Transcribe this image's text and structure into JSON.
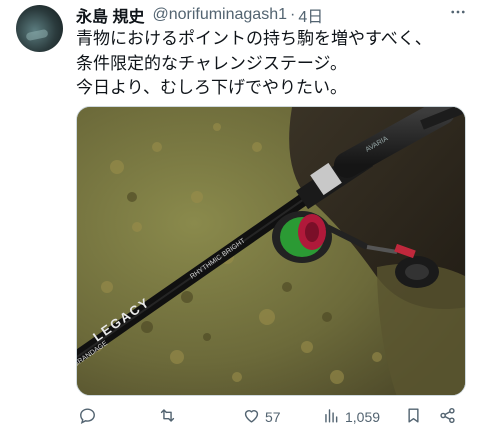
{
  "tweet": {
    "author_name": "永島 規史",
    "handle": "@norifuminagash1",
    "separator": "·",
    "time": "4日",
    "text_lines": [
      "青物におけるポイントの持ち駒を増やすべく、",
      "条件限定的なチャレンジステージ。",
      "今日より、むしろ下げでやりたい。"
    ]
  },
  "media": {
    "rod_text_1": "LEGACY",
    "rod_text_2": "GRANDAGE",
    "rod_text_3": "RHYTHMIC BRIGHT"
  },
  "actions": {
    "reply": {
      "icon": "reply-icon",
      "count": ""
    },
    "retweet": {
      "icon": "retweet-icon",
      "count": ""
    },
    "like": {
      "icon": "like-icon",
      "count": "57"
    },
    "views": {
      "icon": "views-icon",
      "count": "1,059"
    },
    "bookmark": {
      "icon": "bookmark-icon"
    },
    "share": {
      "icon": "share-icon"
    }
  }
}
